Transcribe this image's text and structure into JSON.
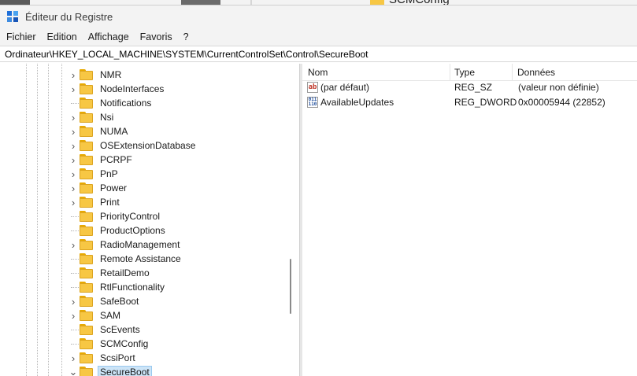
{
  "window": {
    "title": "Éditeur du Registre"
  },
  "backdrop": {
    "text": "SCMConfig"
  },
  "menu": [
    "Fichier",
    "Edition",
    "Affichage",
    "Favoris",
    "?"
  ],
  "address": "Ordinateur\\HKEY_LOCAL_MACHINE\\SYSTEM\\CurrentControlSet\\Control\\SecureBoot",
  "tree": {
    "items": [
      {
        "label": "NMR",
        "expander": "›"
      },
      {
        "label": "NodeInterfaces",
        "expander": "›"
      },
      {
        "label": "Notifications",
        "expander": ""
      },
      {
        "label": "Nsi",
        "expander": "›"
      },
      {
        "label": "NUMA",
        "expander": "›"
      },
      {
        "label": "OSExtensionDatabase",
        "expander": "›"
      },
      {
        "label": "PCRPF",
        "expander": "›"
      },
      {
        "label": "PnP",
        "expander": "›"
      },
      {
        "label": "Power",
        "expander": "›"
      },
      {
        "label": "Print",
        "expander": "›"
      },
      {
        "label": "PriorityControl",
        "expander": ""
      },
      {
        "label": "ProductOptions",
        "expander": ""
      },
      {
        "label": "RadioManagement",
        "expander": "›"
      },
      {
        "label": "Remote Assistance",
        "expander": ""
      },
      {
        "label": "RetailDemo",
        "expander": ""
      },
      {
        "label": "RtlFunctionality",
        "expander": ""
      },
      {
        "label": "SafeBoot",
        "expander": "›"
      },
      {
        "label": "SAM",
        "expander": "›"
      },
      {
        "label": "ScEvents",
        "expander": ""
      },
      {
        "label": "SCMConfig",
        "expander": ""
      },
      {
        "label": "ScsiPort",
        "expander": "›"
      },
      {
        "label": "SecureBoot",
        "expander": "⌄"
      }
    ]
  },
  "values": {
    "columns": {
      "name": "Nom",
      "type": "Type",
      "data": "Données"
    },
    "rows": [
      {
        "icon": "string-value-icon",
        "icon_text": "ab",
        "name": "(par défaut)",
        "type": "REG_SZ",
        "data": "(valeur non définie)"
      },
      {
        "icon": "dword-value-icon",
        "icon_text": "011 110",
        "name": "AvailableUpdates",
        "type": "REG_DWORD",
        "data": "0x00005944 (22852)"
      }
    ]
  },
  "colors": {
    "folder": "#f7c744",
    "selection": "#cce4f7",
    "selection_border": "#99c9ef",
    "chrome": "#f3f3f3"
  }
}
